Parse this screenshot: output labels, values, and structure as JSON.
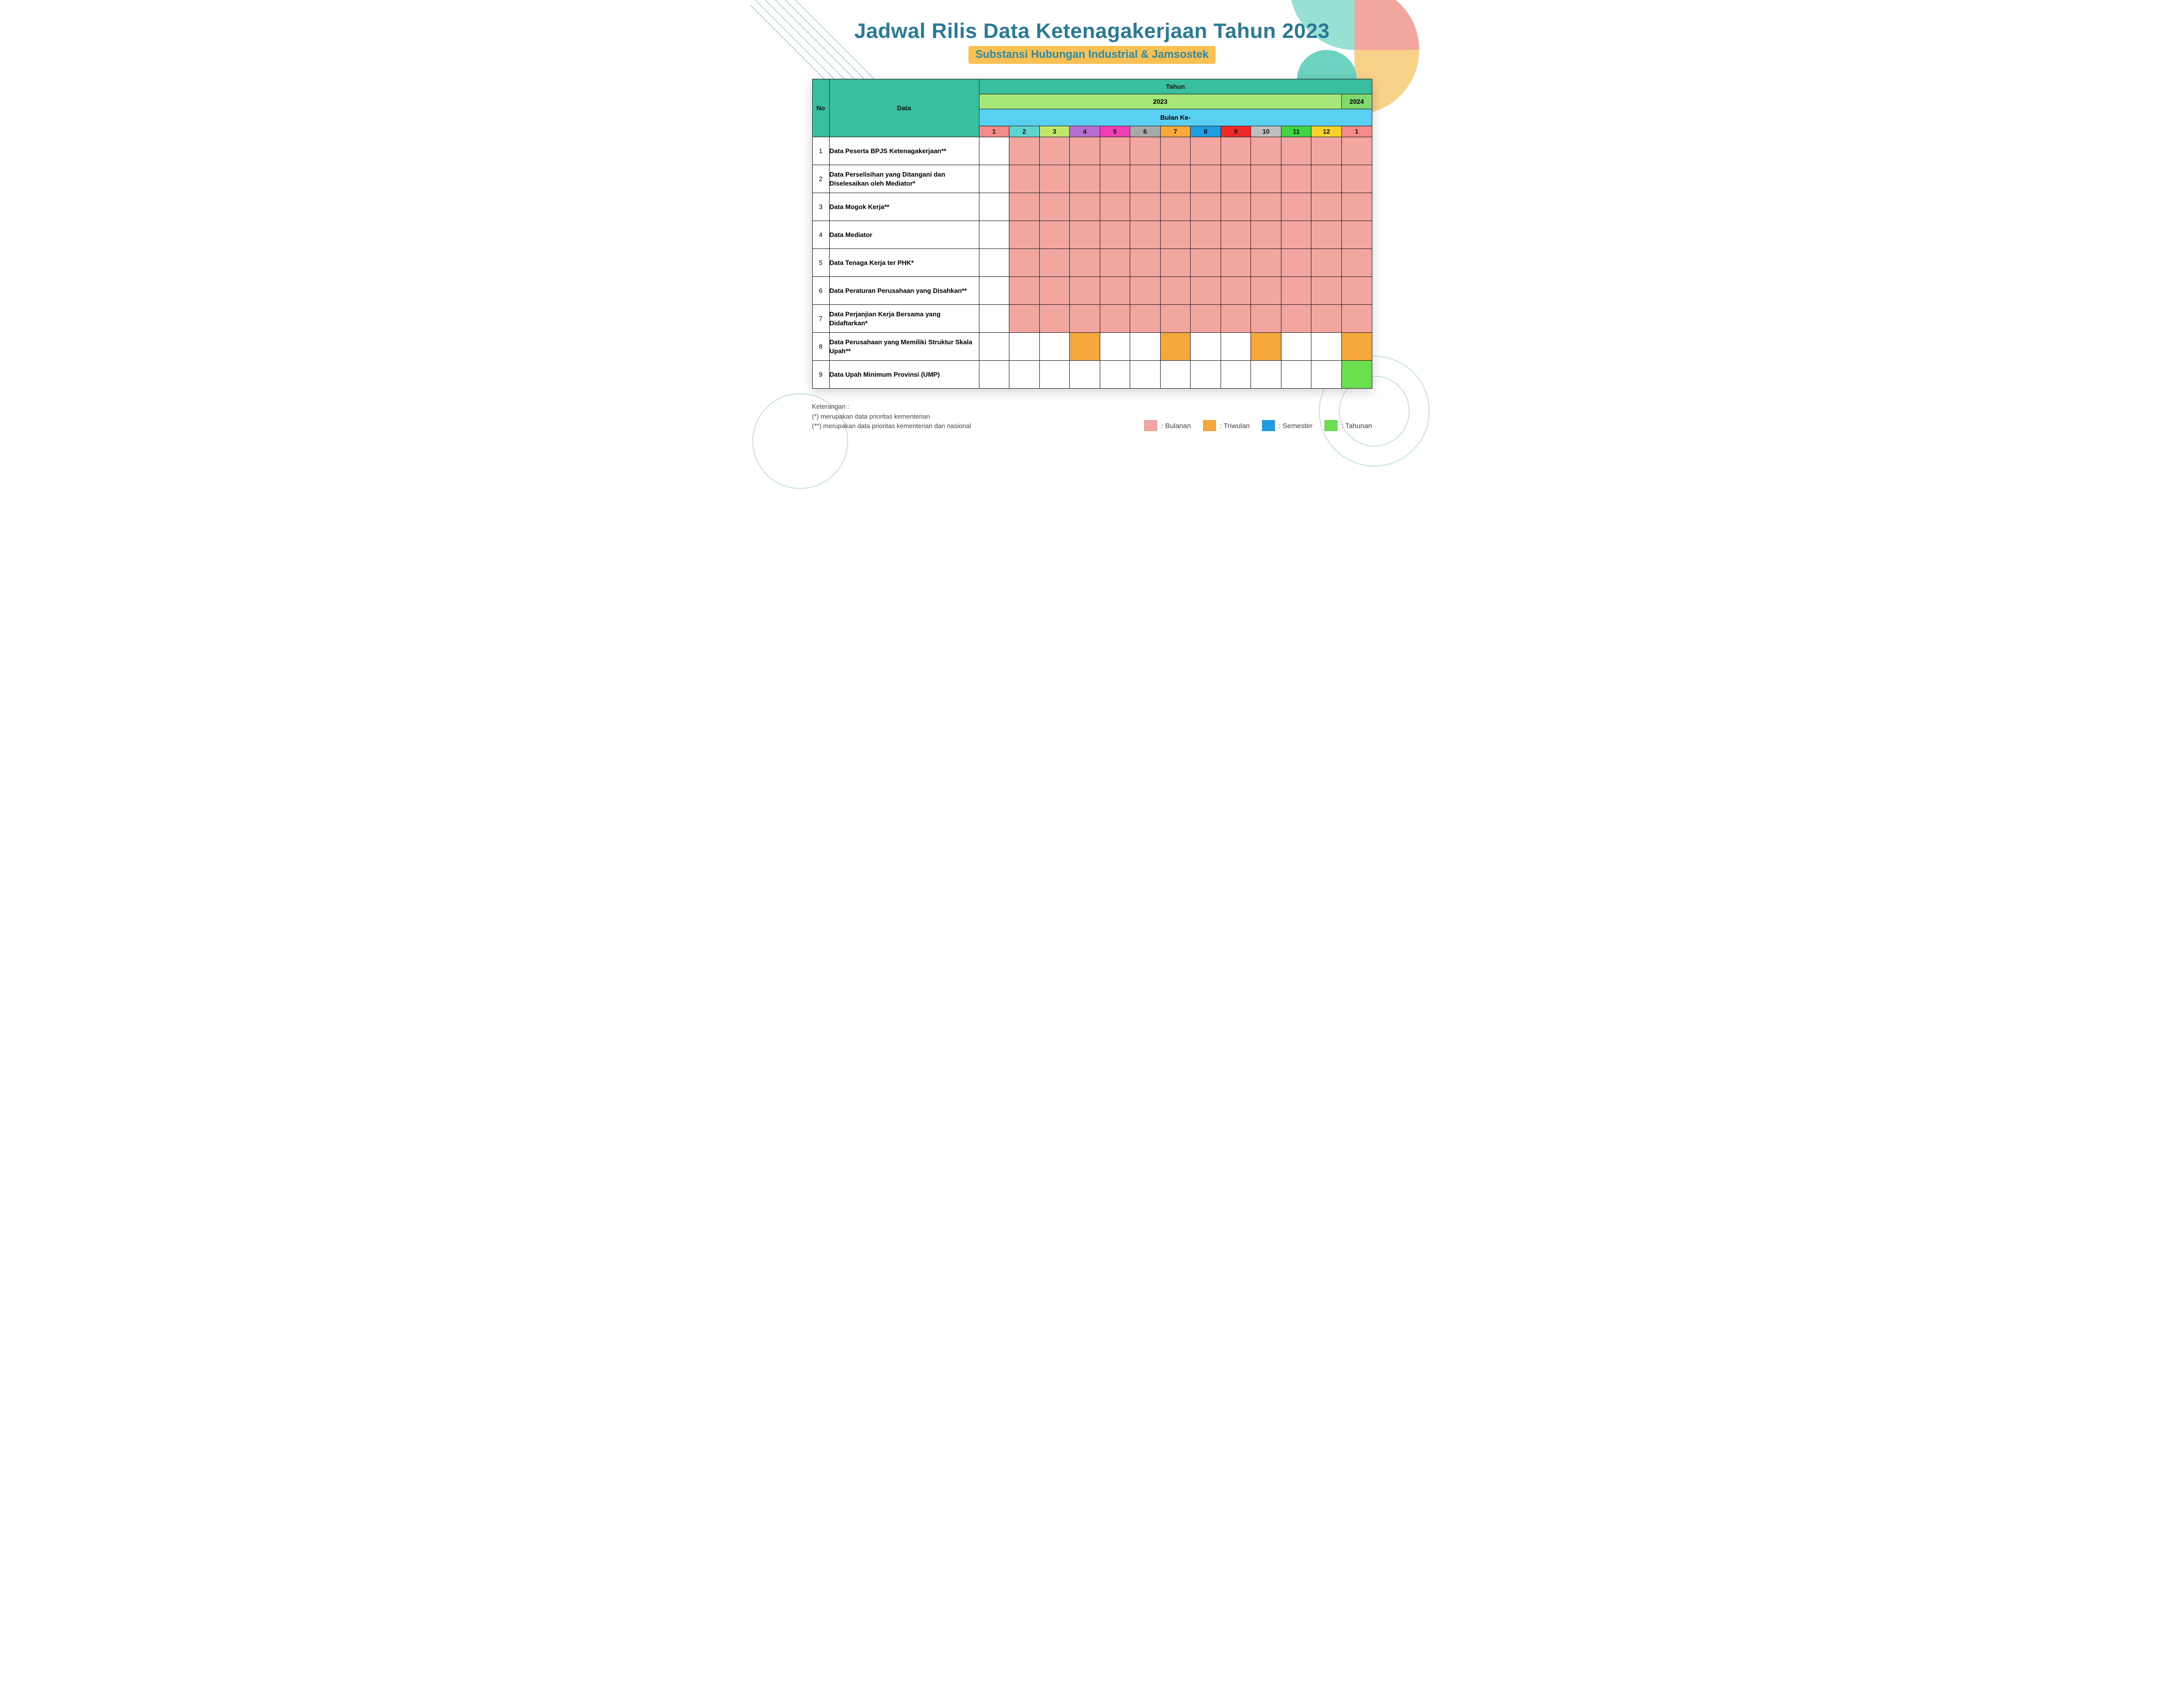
{
  "title": "Jadwal Rilis Data Ketenagakerjaan Tahun 2023",
  "subtitle": "Substansi Hubungan Industrial & Jamsostek",
  "table": {
    "headers": {
      "no": "No",
      "data": "Data",
      "tahun": "Tahun",
      "year_2023": "2023",
      "year_2024": "2024",
      "bulan_ke": "Bulan Ke-",
      "months": [
        "1",
        "2",
        "3",
        "4",
        "5",
        "6",
        "7",
        "8",
        "9",
        "10",
        "11",
        "12",
        "1"
      ]
    },
    "rows": [
      {
        "no": "1",
        "label": "Data Peserta BPJS Ketenagakerjaan**",
        "cells": [
          "",
          "bulanan",
          "bulanan",
          "bulanan",
          "bulanan",
          "bulanan",
          "bulanan",
          "bulanan",
          "bulanan",
          "bulanan",
          "bulanan",
          "bulanan",
          "bulanan"
        ]
      },
      {
        "no": "2",
        "label": "Data Perselisihan yang Ditangani dan Diselesaikan oleh Mediator*",
        "cells": [
          "",
          "bulanan",
          "bulanan",
          "bulanan",
          "bulanan",
          "bulanan",
          "bulanan",
          "bulanan",
          "bulanan",
          "bulanan",
          "bulanan",
          "bulanan",
          "bulanan"
        ]
      },
      {
        "no": "3",
        "label": "Data Mogok Kerja**",
        "cells": [
          "",
          "bulanan",
          "bulanan",
          "bulanan",
          "bulanan",
          "bulanan",
          "bulanan",
          "bulanan",
          "bulanan",
          "bulanan",
          "bulanan",
          "bulanan",
          "bulanan"
        ]
      },
      {
        "no": "4",
        "label": "Data Mediator",
        "cells": [
          "",
          "bulanan",
          "bulanan",
          "bulanan",
          "bulanan",
          "bulanan",
          "bulanan",
          "bulanan",
          "bulanan",
          "bulanan",
          "bulanan",
          "bulanan",
          "bulanan"
        ]
      },
      {
        "no": "5",
        "label": "Data Tenaga Kerja ter PHK*",
        "cells": [
          "",
          "bulanan",
          "bulanan",
          "bulanan",
          "bulanan",
          "bulanan",
          "bulanan",
          "bulanan",
          "bulanan",
          "bulanan",
          "bulanan",
          "bulanan",
          "bulanan"
        ]
      },
      {
        "no": "6",
        "label": "Data Peraturan Perusahaan yang Disahkan**",
        "cells": [
          "",
          "bulanan",
          "bulanan",
          "bulanan",
          "bulanan",
          "bulanan",
          "bulanan",
          "bulanan",
          "bulanan",
          "bulanan",
          "bulanan",
          "bulanan",
          "bulanan"
        ]
      },
      {
        "no": "7",
        "label": "Data Perjanjian Kerja Bersama yang Didaftarkan*",
        "cells": [
          "",
          "bulanan",
          "bulanan",
          "bulanan",
          "bulanan",
          "bulanan",
          "bulanan",
          "bulanan",
          "bulanan",
          "bulanan",
          "bulanan",
          "bulanan",
          "bulanan"
        ]
      },
      {
        "no": "8",
        "label": "Data Perusahaan yang Memiliki Struktur Skala Upah**",
        "cells": [
          "",
          "",
          "",
          "triwulan",
          "",
          "",
          "triwulan",
          "",
          "",
          "triwulan",
          "",
          "",
          "triwulan"
        ]
      },
      {
        "no": "9",
        "label": "Data Upah Minimum Provinsi (UMP)",
        "cells": [
          "",
          "",
          "",
          "",
          "",
          "",
          "",
          "",
          "",
          "",
          "",
          "",
          "tahunan"
        ]
      }
    ]
  },
  "footer": {
    "keterangan_label": "Keterangan :",
    "note1": "(*) merupakan data prioritas kementerian",
    "note2": "(**) merupakan data prioritas kementerian dan nasional"
  },
  "legend": {
    "bulanan": {
      "label": ": Bulanan",
      "color": "#f3a6a0"
    },
    "triwulan": {
      "label": ": Triwulan",
      "color": "#f7a83a"
    },
    "semester": {
      "label": ": Semester",
      "color": "#1f9de0"
    },
    "tahunan": {
      "label": ": Tahunan",
      "color": "#6ae04f"
    }
  },
  "colors": {
    "title": "#2a7a96",
    "subtitle_bg": "#f9c053",
    "header_teal": "#38bfa0"
  }
}
